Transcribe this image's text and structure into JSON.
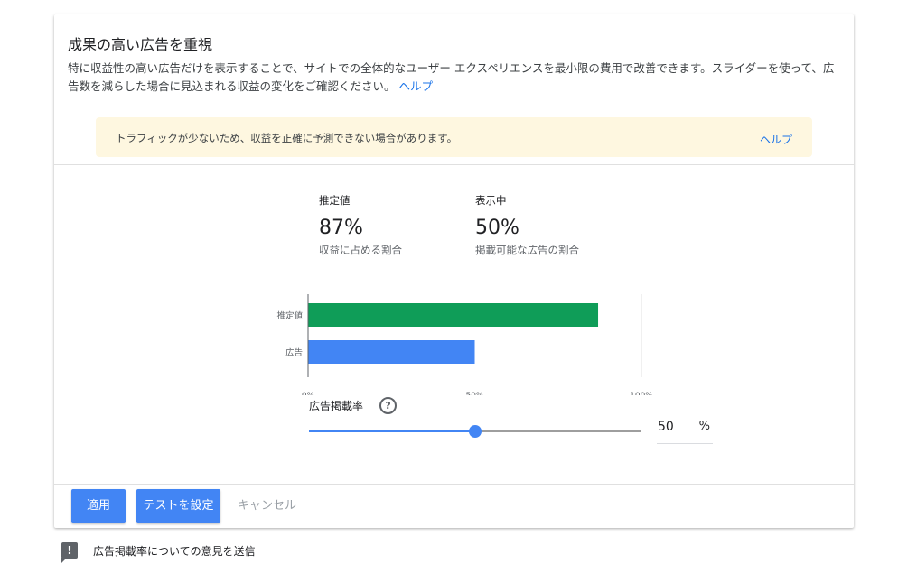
{
  "panel": {
    "title": "成果の高い広告を重視",
    "description": "特に収益性の高い広告だけを表示することで、サイトでの全体的なユーザー エクスペリエンスを最小限の費用で改善できます。スライダーを使って、広告数を減らした場合に見込まれる収益の変化をご確認ください。",
    "help_link": "ヘルプ"
  },
  "alert": {
    "message": "トラフィックが少ないため、収益を正確に予測できない場合があります。",
    "help_link": "ヘルプ"
  },
  "stats": {
    "estimate": {
      "label": "推定値",
      "value": "87%",
      "caption": "収益に占める割合"
    },
    "showing": {
      "label": "表示中",
      "value": "50%",
      "caption": "掲載可能な広告の割合"
    }
  },
  "chart_data": {
    "type": "bar",
    "orientation": "horizontal",
    "categories": [
      "推定値",
      "広告"
    ],
    "values": [
      87,
      50
    ],
    "colors": [
      "#0f9d58",
      "#4285f4"
    ],
    "xlim": [
      0,
      100
    ],
    "xticks": [
      "0%",
      "50%",
      "100%"
    ],
    "grid": false
  },
  "slider": {
    "label": "広告掲載率",
    "help_icon": "question-circle-icon",
    "value": 50,
    "value_text": "50",
    "unit": "%"
  },
  "actions": {
    "apply": "適用",
    "set_test": "テストを設定",
    "cancel": "キャンセル"
  },
  "feedback": {
    "icon": "feedback-icon",
    "label": "広告掲載率についての意見を送信"
  },
  "colors": {
    "primary": "#4285f4",
    "estimate_bar": "#0f9d58",
    "alert_bg": "#fef7e0",
    "link": "#1a73e8"
  }
}
